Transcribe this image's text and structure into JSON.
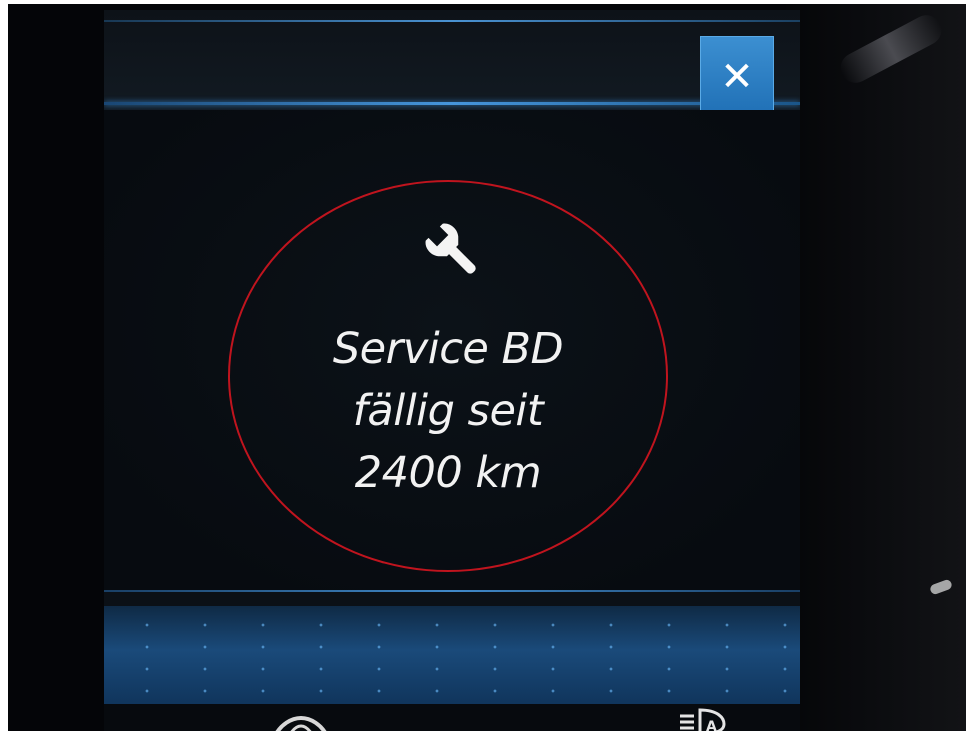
{
  "close_button": {
    "label": "✕",
    "icon": "close-icon",
    "color": "#2a7fc4"
  },
  "message": {
    "icon": "wrench-icon",
    "lines": [
      "Service BD",
      "fällig seit",
      "2400 km"
    ]
  },
  "highlight": {
    "shape": "ellipse",
    "color": "#c0141e"
  },
  "status_bar": {
    "icons": [
      "lane-assist-icon",
      "auto-headlight-icon"
    ]
  },
  "colors": {
    "accent": "#3c8fd1",
    "screen_background": "#0b1016",
    "text": "#f2f2f2"
  }
}
